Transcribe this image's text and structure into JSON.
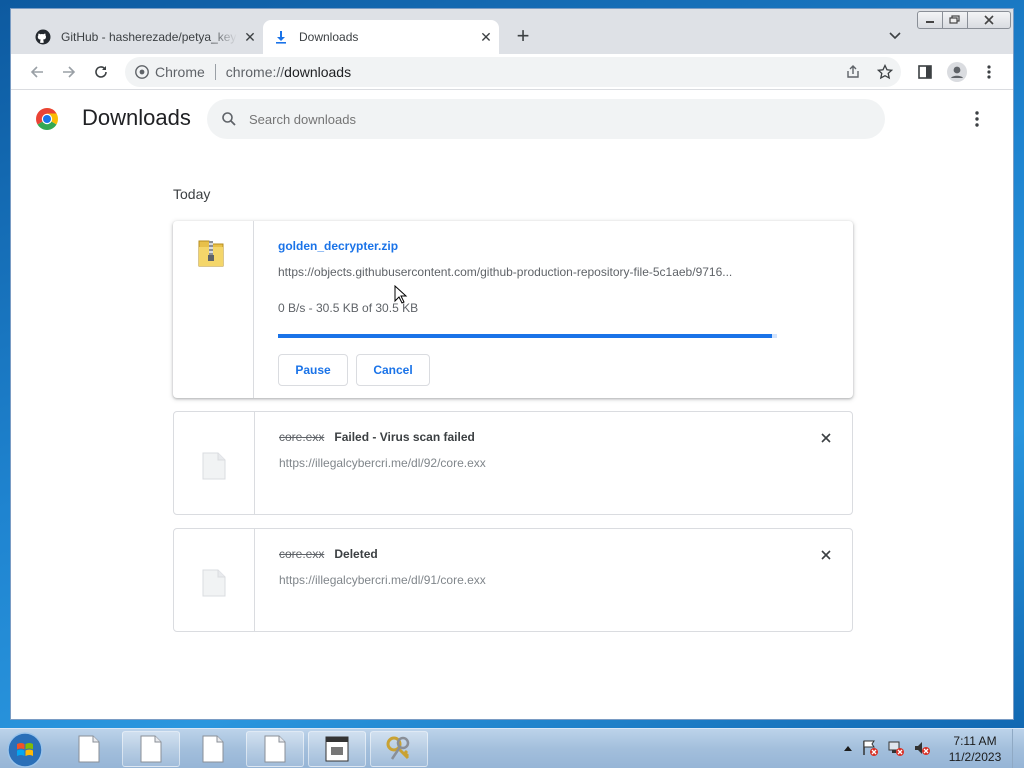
{
  "browser": {
    "tabs": [
      {
        "title": "GitHub - hasherezade/petya_key",
        "icon": "github-icon",
        "active": false
      },
      {
        "title": "Downloads",
        "icon": "download-icon",
        "active": true
      }
    ],
    "omnibox": {
      "secure_label": "Chrome",
      "url_scheme": "chrome://",
      "url_host": "downloads"
    }
  },
  "downloads_page": {
    "title": "Downloads",
    "search_placeholder": "Search downloads",
    "date_group": "Today",
    "items": [
      {
        "file_name": "golden_decrypter.zip",
        "url": "https://objects.githubusercontent.com/github-production-repository-file-5c1aeb/9716...",
        "progress_text": "0 B/s - 30.5 KB of 30.5 KB",
        "progress_fraction": 0.99,
        "pause_label": "Pause",
        "cancel_label": "Cancel"
      },
      {
        "file_name": "core.exx",
        "status": "Failed - Virus scan failed",
        "url": "https://illegalcybercri.me/dl/92/core.exx"
      },
      {
        "file_name": "core.exx",
        "status": "Deleted",
        "url": "https://illegalcybercri.me/dl/91/core.exx"
      }
    ]
  },
  "taskbar": {
    "clock_time": "7:11 AM",
    "clock_date": "11/2/2023"
  },
  "colors": {
    "accent": "#1a73e8",
    "tabstrip": "#dee1e6",
    "taskbar": "#a3bfdc"
  }
}
